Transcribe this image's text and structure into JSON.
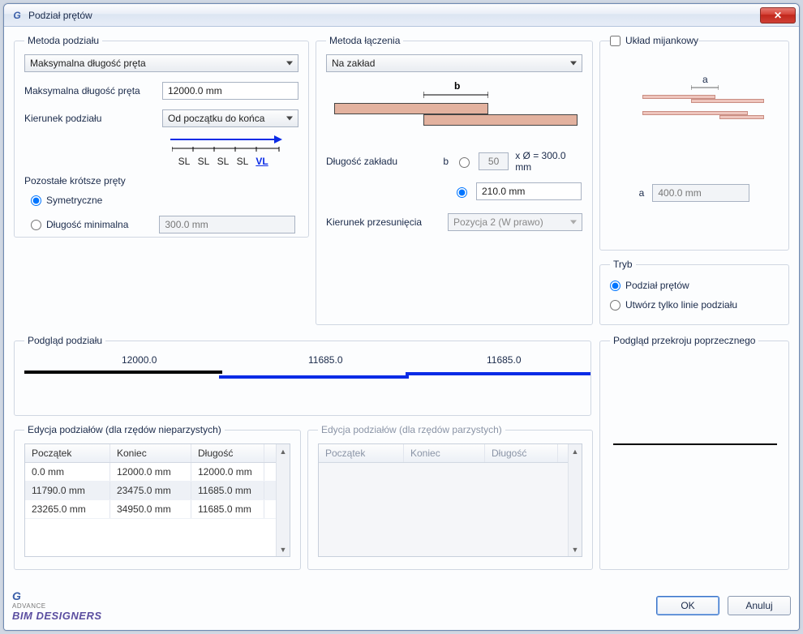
{
  "title": "Podział prętów",
  "metodaPodzialu": {
    "legend": "Metoda podziału",
    "methodSelect": "Maksymalna długość pręta",
    "maxLengthLabel": "Maksymalna długość pręta",
    "maxLengthValue": "12000.0 mm",
    "directionLabel": "Kierunek podziału",
    "directionSelect": "Od początku do końca",
    "segLabels": [
      "SL",
      "SL",
      "SL",
      "SL",
      "VL"
    ],
    "remainderLabel": "Pozostałe krótsze pręty",
    "radioSymmetric": "Symetryczne",
    "radioMinLength": "Długość minimalna",
    "minLengthValue": "300.0 mm"
  },
  "metodaLaczenia": {
    "legend": "Metoda łączenia",
    "methodSelect": "Na zakład",
    "lapLengthLabel": "Długość zakładu",
    "bLabel": "b",
    "multValue": "50",
    "multSuffix": "x Ø = 300.0 mm",
    "fixedValue": "210.0 mm",
    "offsetDirLabel": "Kierunek przesunięcia",
    "offsetDirSelect": "Pozycja 2 (W prawo)"
  },
  "mijankowy": {
    "check": "Układ mijankowy",
    "aLabel": "a",
    "aValue": "400.0 mm"
  },
  "tryb": {
    "legend": "Tryb",
    "radioSplit": "Podział prętów",
    "radioLines": "Utwórz tylko linie podziału"
  },
  "preview": {
    "legend": "Podgląd podziału",
    "seg1": "12000.0",
    "seg2": "11685.0",
    "seg3": "11685.0"
  },
  "crossPreview": {
    "legend": "Podgląd przekroju poprzecznego"
  },
  "editOdd": {
    "legend": "Edycja podziałów (dla rzędów nieparzystych)",
    "colStart": "Początek",
    "colEnd": "Koniec",
    "colLen": "Długość",
    "rows": [
      {
        "s": "0.0 mm",
        "e": "12000.0 mm",
        "l": "12000.0 mm"
      },
      {
        "s": "11790.0 mm",
        "e": "23475.0 mm",
        "l": "11685.0 mm"
      },
      {
        "s": "23265.0 mm",
        "e": "34950.0 mm",
        "l": "11685.0 mm"
      }
    ]
  },
  "editEven": {
    "legend": "Edycja podziałów (dla rzędów parzystych)",
    "colStart": "Początek",
    "colEnd": "Koniec",
    "colLen": "Długość"
  },
  "buttons": {
    "ok": "OK",
    "cancel": "Anuluj"
  },
  "logo": {
    "top": "ADVANCE",
    "main": "BIM DESIGNERS"
  },
  "colors": {
    "black": "#000000",
    "blue": "#0a2be6"
  }
}
